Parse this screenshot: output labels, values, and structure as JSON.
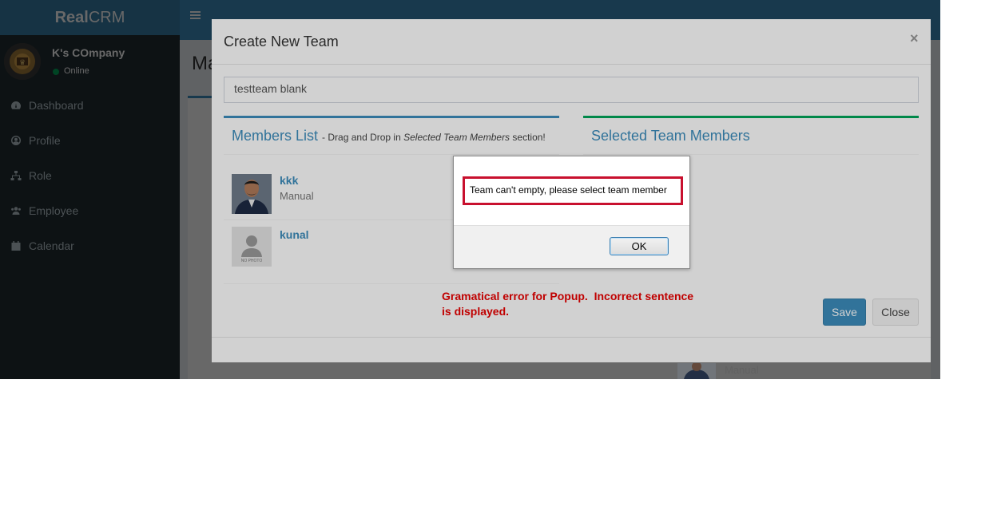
{
  "app": {
    "logo_bold": "Real",
    "logo_regular": "CRM",
    "user": {
      "name": "K's COmpany",
      "status": "Online"
    },
    "menu": [
      {
        "label": "Dashboard",
        "icon": "dashboard-icon"
      },
      {
        "label": "Profile",
        "icon": "user-circle-icon"
      },
      {
        "label": "Role",
        "icon": "sitemap-icon"
      },
      {
        "label": "Employee",
        "icon": "users-icon"
      },
      {
        "label": "Calendar",
        "icon": "calendar-icon"
      }
    ],
    "content_title": "Ma"
  },
  "modal": {
    "title": "Create New Team",
    "close_symbol": "×",
    "team_name_value": "testteam blank",
    "members_panel": {
      "title": "Members List",
      "hint_prefix": "- Drag and Drop in",
      "hint_italic": "Selected Team Members",
      "hint_suffix": "section!",
      "members": [
        {
          "name": "kkk",
          "role": "Manual",
          "photo": "person-photo"
        },
        {
          "name": "kunal",
          "role": "",
          "photo": "no-photo-placeholder",
          "photo_text": "NO PHOTO"
        }
      ]
    },
    "selected_panel": {
      "title": "Selected Team Members"
    },
    "save_label": "Save",
    "close_label": "Close",
    "peek_role": "Manual"
  },
  "alert": {
    "message": "Team can't empty, please select team member",
    "ok_label": "OK"
  },
  "annotation": {
    "line1": "Gramatical error for Popup.  Incorrect sentence",
    "line2": "is displayed.",
    "color": "#c00000"
  },
  "colors": {
    "primary": "#3c8dbc",
    "success": "#00a65a",
    "sidebar": "#222d32",
    "highlight": "#c8102e"
  }
}
